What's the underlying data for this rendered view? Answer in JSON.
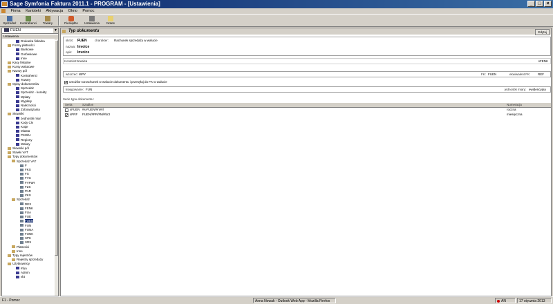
{
  "window": {
    "title": "Sage Symfonia Faktura 2011.1 - PROGRAM - [Ustawienia]"
  },
  "menu": [
    "Firma",
    "Kartoteki",
    "Aktywacja",
    "Okno",
    "Pomoc"
  ],
  "toolbar": {
    "buttons": [
      {
        "label": "Sprzedaż",
        "icon": "sales-icon"
      },
      {
        "label": "Kontrahenci",
        "icon": "contractors-icon"
      },
      {
        "label": "Towary",
        "icon": "goods-icon"
      },
      {
        "label": "Pieniądze",
        "icon": "money-icon"
      },
      {
        "label": "Ustawienia",
        "icon": "settings-icon"
      },
      {
        "label": "Notes",
        "icon": "notes-icon"
      }
    ]
  },
  "sidebar": {
    "combo_value": "FUEN",
    "header": "Ustawienia",
    "tree": [
      {
        "label": "Drukarka fiskalna",
        "level": 3
      },
      {
        "label": "Formy płatności",
        "level": 1
      },
      {
        "label": "Bankowe",
        "level": 3
      },
      {
        "label": "Gotówkowe",
        "level": 3
      },
      {
        "label": "Inne",
        "level": 3
      },
      {
        "label": "Kasy fiskalne",
        "level": 1
      },
      {
        "label": "Kursy walutowe",
        "level": 1
      },
      {
        "label": "Nazwy pól",
        "level": 1
      },
      {
        "label": "Kontrahenci",
        "level": 3
      },
      {
        "label": "Towary",
        "level": 3
      },
      {
        "label": "Opisy dokumentów",
        "level": 1
      },
      {
        "label": "Sprzedaż",
        "level": 3
      },
      {
        "label": "Sprzedaż - korekty",
        "level": 3
      },
      {
        "label": "Wpłaty",
        "level": 3
      },
      {
        "label": "Wypłaty",
        "level": 3
      },
      {
        "label": "Należności",
        "level": 3
      },
      {
        "label": "Zobowiązania",
        "level": 3
      },
      {
        "label": "Słowniki",
        "level": 1
      },
      {
        "label": "Jednostki miar",
        "level": 3
      },
      {
        "label": "Kody CN",
        "level": 3
      },
      {
        "label": "Kraje",
        "level": 3
      },
      {
        "label": "Miasta",
        "level": 3
      },
      {
        "label": "PKWiU",
        "level": 3
      },
      {
        "label": "Regiony",
        "level": 3
      },
      {
        "label": "Waluty",
        "level": 3
      },
      {
        "label": "Słowniki pól",
        "level": 1
      },
      {
        "label": "Stawki VAT",
        "level": 1
      },
      {
        "label": "Typy dokumentów",
        "level": 1
      },
      {
        "label": "Sprzedaż VAT",
        "level": 2
      },
      {
        "label": "F",
        "level": 4
      },
      {
        "label": "FKS",
        "level": 4
      },
      {
        "label": "FS",
        "level": 4
      },
      {
        "label": "FVS",
        "level": 4
      },
      {
        "label": "FVPaR",
        "level": 4
      },
      {
        "label": "FZS",
        "level": 4
      },
      {
        "label": "PAR",
        "level": 4
      },
      {
        "label": "ZKS",
        "level": 4
      },
      {
        "label": "Sprzedaż",
        "level": 2
      },
      {
        "label": "DEX",
        "level": 4
      },
      {
        "label": "FENK",
        "level": 4
      },
      {
        "label": "FUA",
        "level": 4
      },
      {
        "label": "FUE",
        "level": 4
      },
      {
        "label": "FUEN",
        "level": 4,
        "selected": true
      },
      {
        "label": "FUN",
        "level": 4
      },
      {
        "label": "FUNA",
        "level": 4
      },
      {
        "label": "FUNK",
        "level": 4
      },
      {
        "label": "SPK",
        "level": 4
      },
      {
        "label": "SRS",
        "level": 4
      },
      {
        "label": "Płatności",
        "level": 2
      },
      {
        "label": "Inne",
        "level": 2
      },
      {
        "label": "Typy rejestrów",
        "level": 1
      },
      {
        "label": "Rejestry sprzedaży",
        "level": 2
      },
      {
        "label": "Użytkownicy",
        "level": 1
      },
      {
        "label": "#fun",
        "level": 3
      },
      {
        "label": "Admin",
        "level": 3
      },
      {
        "label": "vbt",
        "level": 3
      }
    ]
  },
  "main": {
    "title": "Typ dokumentu",
    "edit_label": "Edytuj",
    "fields": {
      "skrot_label": "skrót:",
      "skrot_value": "FUEN",
      "charakter_label": "charakter:",
      "charakter_value": "Rachunek sprzedaży w walucie",
      "nazwa_label": "nazwa:",
      "nazwa_value": "Invoice",
      "opis_label": "opis:",
      "opis_value": "Invoice",
      "kontekst_label": "Kontekst:",
      "kontekst_value": "Invoice",
      "kontekst_right": "sFENK",
      "wzorzec_label": "wzorzec:",
      "wzorzec_value": "WPY",
      "fk_label": "FK:",
      "fk_value": "FUEN",
      "ekwiwalent_label": "ekwiwalent FK:",
      "ekwiwalent_value": "REF",
      "checkbox_label": "umożliw rozrachunek w walucie dokumentu i przesyłaj do FK w walucie",
      "ksiegowanie_label": "księgowanie:",
      "ksiegowanie_value": "FUN",
      "jednostka_label": "jednostki miary:",
      "jednostka_value": "ewidencyjna"
    },
    "series": {
      "title": "Serie typu dokumentu:",
      "columns": [
        "Seria",
        "Szablon",
        "Numeracja"
      ],
      "rows": [
        {
          "seria": "sFUEN",
          "szablon": "#s-FUEN/#n/#rl",
          "numeracja": "roczna",
          "checked": false
        },
        {
          "seria": "sPRF",
          "szablon": "FUEN/#PR/#M/#br3",
          "numeracja": "miesięczna",
          "checked": true
        }
      ]
    }
  },
  "statusbar": {
    "left": "F1 - Pomoc",
    "taskbar_item": "Anna Nowak - Outlook Web App - Mozilla Firefox",
    "lang": "AN",
    "date": "17 stycznia 2013"
  }
}
